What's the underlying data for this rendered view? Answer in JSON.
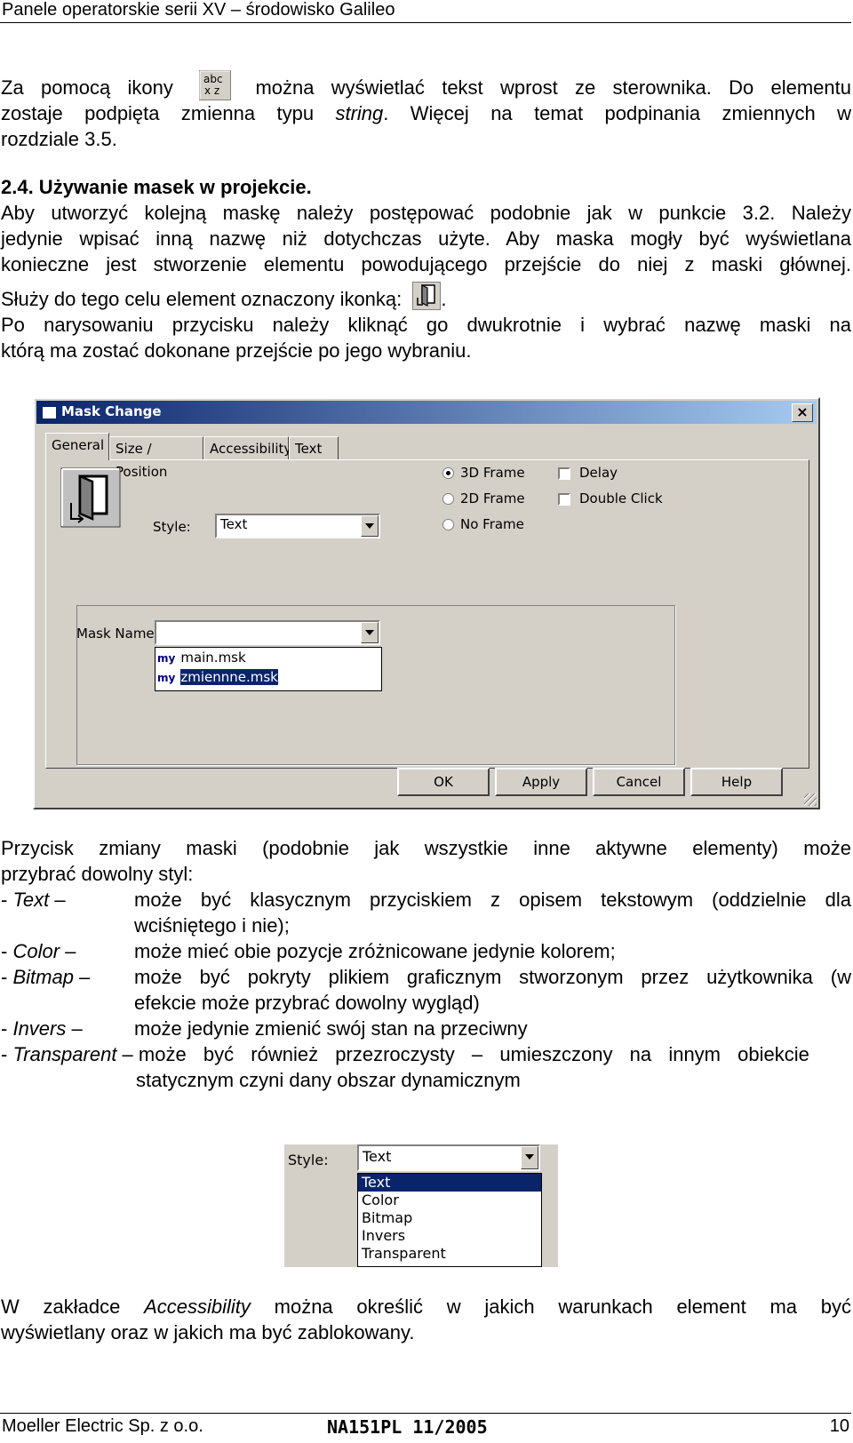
{
  "header": {
    "title": "Panele operatorskie serii XV – środowisko Galileo"
  },
  "p1": {
    "before_icon": "Za pomocą ikony",
    "after_icon": "można wyświetlać tekst wprost ze sterownika. Do elementu",
    "line2_a": "zostaje podpięta zmienna typu ",
    "line2_em": "string",
    "line2_b": ". Więcej na temat podpinania zmiennych w",
    "line3": "rozdziale 3.5.",
    "icon_text_top": "abc",
    "icon_text_bottom": "x z"
  },
  "section": {
    "heading": "2.4. Używanie masek w projekcie.",
    "l1": "Aby utworzyć kolejną maskę należy postępować podobnie jak w punkcie 3.2. Należy",
    "l2": "jedynie wpisać inną nazwę niż dotychczas użyte. Aby maska mogły być wyświetlana",
    "l3": "konieczne jest stworzenie elementu powodującego przejście do niej z maski głównej.",
    "l4": "Służy do tego celu element oznaczony ikonką:",
    "l4_end": ".",
    "l5": "Po narysowaniu przycisku należy kliknąć go dwukrotnie i wybrać nazwę maski na",
    "l6": "którą ma zostać dokonane przejście po jego wybraniu."
  },
  "dialog": {
    "title": "Mask Change",
    "close": "×",
    "tabs": [
      "General",
      "Size / Position",
      "Accessibility",
      "Text"
    ],
    "style_label": "Style:",
    "style_value": "Text",
    "radios": [
      {
        "label": "3D Frame",
        "checked": true
      },
      {
        "label": "2D Frame",
        "checked": false
      },
      {
        "label": "No Frame",
        "checked": false
      }
    ],
    "checkboxes": [
      {
        "label": "Delay",
        "checked": false
      },
      {
        "label": "Double Click",
        "checked": false
      }
    ],
    "mask_name_label": "Mask Name:",
    "mask_name_value": "",
    "list_items": [
      {
        "prefix": "my",
        "label": "main.msk",
        "selected": false
      },
      {
        "prefix": "my",
        "label": "zmiennne.msk",
        "selected": true
      }
    ],
    "buttons": [
      "OK",
      "Apply",
      "Cancel",
      "Help"
    ]
  },
  "styles_text": {
    "intro1": "Przycisk zmiany maski (podobnie jak wszystkie inne aktywne elementy) może",
    "intro2": "przybrać dowolny styl:",
    "items": [
      {
        "term": "Text",
        "desc1": "może być klasycznym przyciskiem z opisem tekstowym (oddzielnie dla",
        "desc2": "wciśniętego i nie);"
      },
      {
        "term": "Color",
        "desc1": "może mieć obie pozycje zróżnicowane jedynie kolorem;",
        "desc2": ""
      },
      {
        "term": "Bitmap",
        "desc1": "może być pokryty plikiem graficznym stworzonym przez użytkownika (w",
        "desc2": "efekcie może przybrać dowolny wygląd)"
      },
      {
        "term": "Invers",
        "desc1": "może jedynie zmienić swój stan na przeciwny",
        "desc2": ""
      },
      {
        "term": "Transparent",
        "desc1": "może być również przezroczysty – umieszczony na innym obiekcie",
        "desc2": "statycznym czyni dany obszar dynamicznym"
      }
    ]
  },
  "style_dropdown": {
    "label": "Style:",
    "value": "Text",
    "options": [
      "Text",
      "Color",
      "Bitmap",
      "Invers",
      "Transparent"
    ],
    "selected_index": 0
  },
  "accessibility_text": {
    "l1_a": "W zakładce ",
    "l1_em": "Accessibility",
    "l1_b": " można określić w jakich warunkach element ma być",
    "l2": "wyświetlany oraz w jakich ma być zablokowany."
  },
  "footer": {
    "company": "Moeller Electric Sp. z o.o.",
    "doc": "NA151PL 11/2005",
    "page": "10"
  }
}
